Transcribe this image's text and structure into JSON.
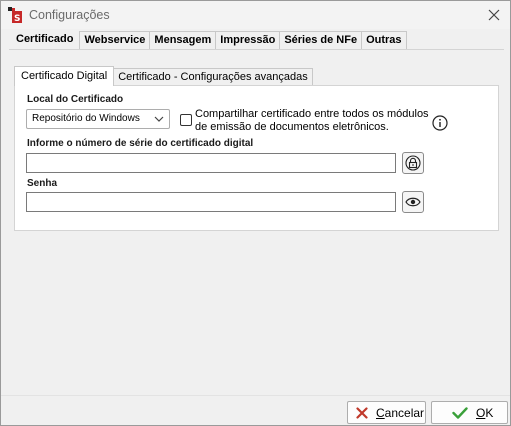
{
  "window": {
    "title": "Configurações"
  },
  "main_tabs": [
    {
      "label": "Certificado",
      "active": true
    },
    {
      "label": "Webservice",
      "active": false
    },
    {
      "label": "Mensagem",
      "active": false
    },
    {
      "label": "Impressão",
      "active": false
    },
    {
      "label": "Séries de NFe",
      "active": false
    },
    {
      "label": "Outras",
      "active": false
    }
  ],
  "sub_tabs": [
    {
      "label": "Certificado Digital",
      "active": true
    },
    {
      "label": "Certificado - Configurações avançadas",
      "active": false
    }
  ],
  "form": {
    "location_label": "Local do Certificado",
    "location_value": "Repositório do Windows",
    "share_checkbox_label": "Compartilhar certificado entre todos os módulos de emissão de documentos eletrônicos.",
    "share_checked": false,
    "serial_label": "Informe o número de série do certificado digital",
    "serial_value": "",
    "password_label": "Senha",
    "password_value": ""
  },
  "buttons": {
    "cancel_mnemonic": "C",
    "cancel_rest": "ancelar",
    "ok_mnemonic": "O",
    "ok_rest": "K"
  },
  "colors": {
    "cancel_icon": "#c0392b",
    "ok_icon": "#3aa03a",
    "app_icon": "#c62828"
  }
}
